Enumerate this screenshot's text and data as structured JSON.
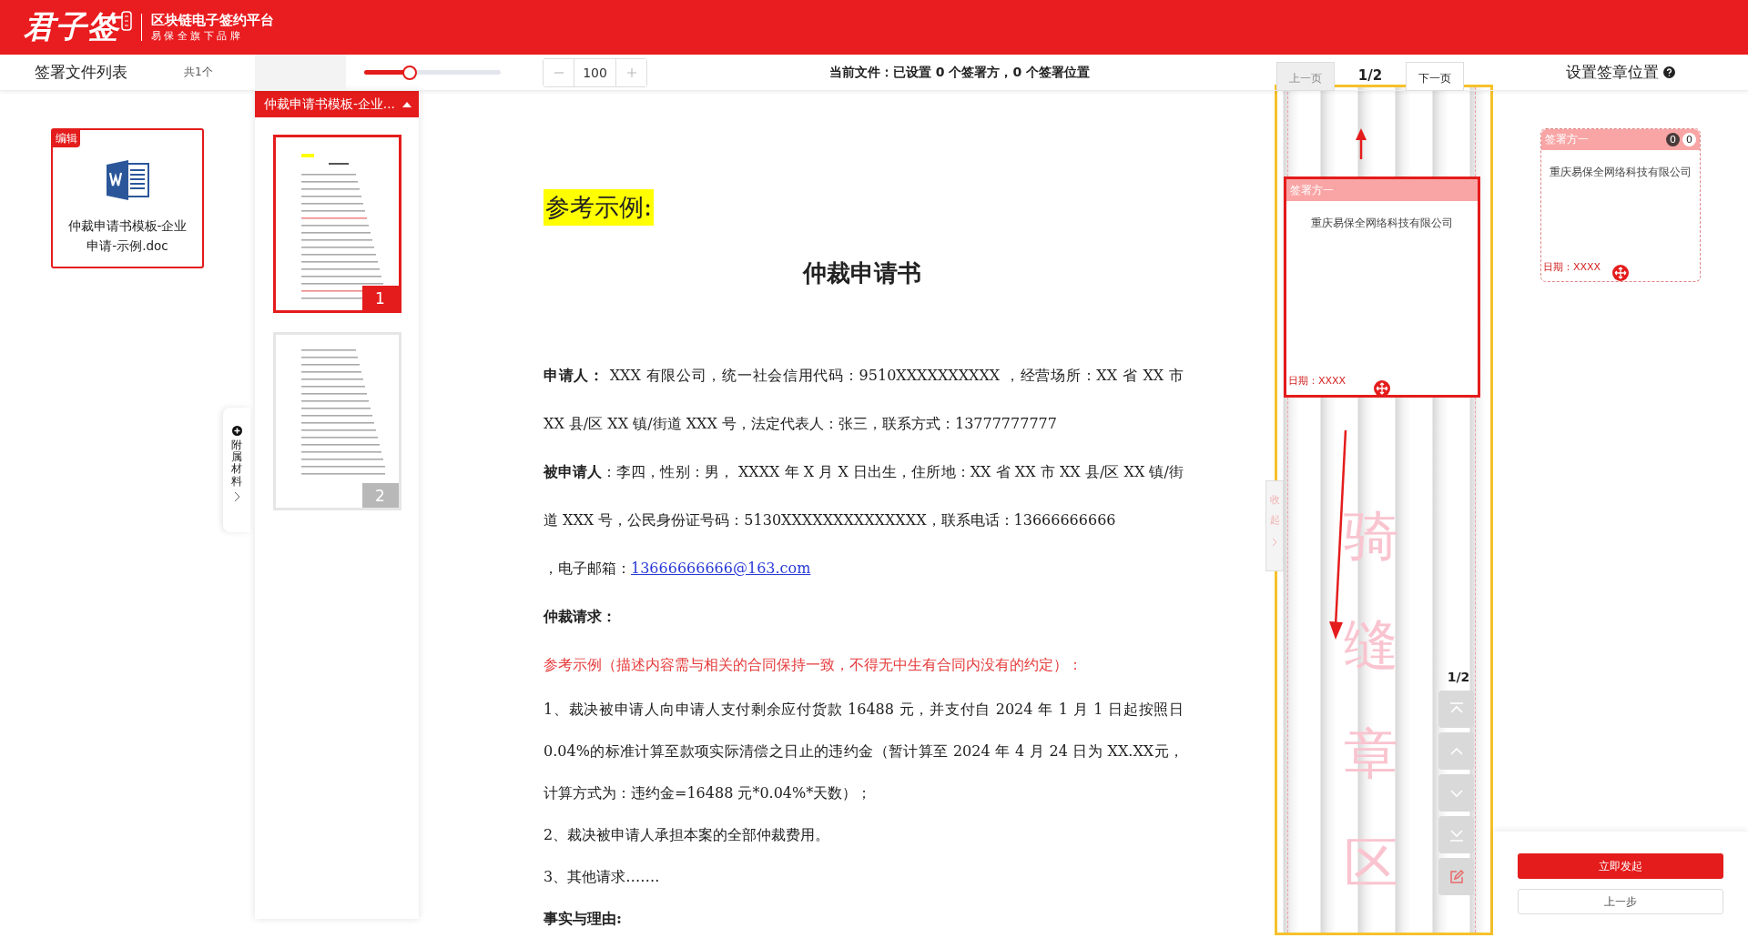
{
  "header": {
    "logo": "君子签",
    "platform": "区块链电子签约平台",
    "slogan": "易 保 全 旗 下 品 牌"
  },
  "file_list": {
    "title": "签署文件列表",
    "count": "共1个",
    "files": [
      {
        "name": "仲裁申请书模板-企业申请-示例.doc",
        "badge": "编辑",
        "selected": true
      }
    ]
  },
  "attachments_tab": {
    "label": "附属材料"
  },
  "zoom": {
    "level": 0.33,
    "value": "100"
  },
  "current_file": "当前文件：已设置 0 个签署方，0 个签署位置",
  "pager": {
    "prev": {
      "label": "上一页",
      "disabled": true
    },
    "page": "1/2",
    "next": {
      "label": "下一页",
      "disabled": false
    }
  },
  "panel_title": "设置签章位置",
  "thumbnails": {
    "tab": "仲裁申请书模板-企业...",
    "pages": [
      {
        "number": "1",
        "selected": true
      },
      {
        "number": "2",
        "selected": false
      }
    ]
  },
  "document": {
    "heading": "参考示例:",
    "title": "仲裁申请书",
    "paragraphs": [
      {
        "kind": "text",
        "text": "**申请人：** XXX 有限公司，统一社会信用代码：9510XXXXXXXXXX ，经营场所：XX 省 XX 市 XX 县/区 XX 镇/街道 XXX 号，法定代表人：张三，联系方式：13777777777"
      },
      {
        "kind": "text",
        "text": "**被申请人**：李四，性别：男， XXXX 年 X 月 X 日出生，住所地：XX 省 XX 市 XX 县/区 XX 镇/街道 XXX 号，公民身份证号码：5130XXXXXXXXXXXXXX，联系电话：13666666666"
      },
      {
        "kind": "email",
        "text": "，电子邮箱：",
        "link": "13666666666@163.com"
      },
      {
        "kind": "heading",
        "text": "仲裁请求："
      },
      {
        "kind": "red",
        "text": "参考示例（描述内容需与相关的合同保持一致，不得无中生有合同内没有的约定）："
      },
      {
        "kind": "text",
        "text": "1、裁决被申请人向申请人支付剩余应付货款 16488 元，并支付自 2024 年 1 月 1 日起按照日 0.04%的标准计算至款项实际清偿之日止的违约金（暂计算至 2024 年 4 月 24 日为 XX.XX元，计算方式为：违约金=16488 元*0.04%*天数）；"
      },
      {
        "kind": "text",
        "text": "2、裁决被申请人承担本案的全部仲裁费用。"
      },
      {
        "kind": "text",
        "text": "3、其他请求……."
      },
      {
        "kind": "heading",
        "text": "事实与理由:"
      }
    ]
  },
  "riding_seal": {
    "watermark": "骑缝章区",
    "collapse": "收起",
    "page": "1/2",
    "signer_box": {
      "party": "签署方一",
      "company": "重庆易保全网络科技有限公司",
      "date": "日期：XXXX"
    }
  },
  "signer_card": {
    "party": "签署方一",
    "counts": [
      "0",
      "0"
    ],
    "company": "重庆易保全网络科技有限公司",
    "date": "日期：XXXX"
  },
  "buttons": [
    {
      "label": "立即发起",
      "kind": "primary"
    },
    {
      "label": "上一步",
      "kind": "secondary"
    }
  ]
}
